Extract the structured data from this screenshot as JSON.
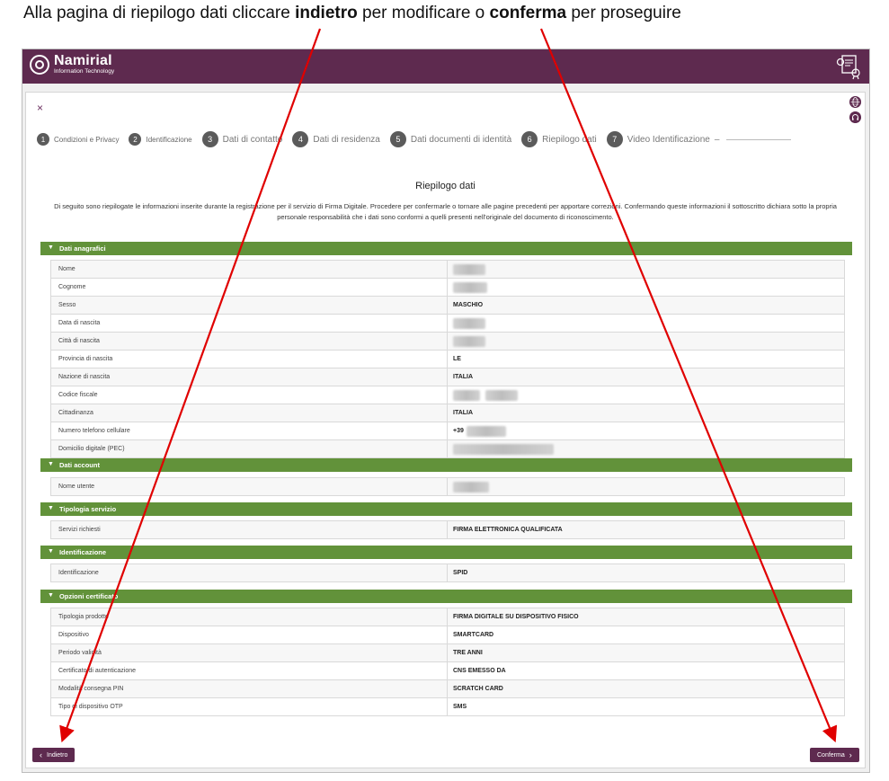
{
  "caption": {
    "pre": "Alla pagina di riepilogo  dati cliccare ",
    "b1": "indietro",
    "mid": " per modificare o ",
    "b2": "conferma",
    "post": " per proseguire"
  },
  "brand": {
    "name": "Namirial",
    "sub": "Information Technology"
  },
  "close_symbol": "×",
  "steps": [
    {
      "num": "1",
      "label": "Condizioni e Privacy"
    },
    {
      "num": "2",
      "label": "Identificazione"
    },
    {
      "num": "3",
      "label": "Dati di contatto"
    },
    {
      "num": "4",
      "label": "Dati di residenza"
    },
    {
      "num": "5",
      "label": "Dati documenti di identità"
    },
    {
      "num": "6",
      "label": "Riepilogo dati"
    },
    {
      "num": "7",
      "label": "Video Identificazione"
    }
  ],
  "step_suffix": "–",
  "title": "Riepilogo dati",
  "intro": "Di seguito sono riepilogate le informazioni inserite durante la registrazione per il servizio di Firma Digitale. Procedere per confermarle o tornare alle pagine precedenti per apportare correzioni. Confermando queste informazioni il sottoscritto dichiara sotto la propria personale responsabilità che i dati sono conformi a quelli presenti nell'originale del documento di riconoscimento.",
  "sections": {
    "anagrafici": {
      "title": "Dati anagrafici",
      "rows": [
        {
          "label": "Nome",
          "value": ""
        },
        {
          "label": "Cognome",
          "value": ""
        },
        {
          "label": "Sesso",
          "value": "MASCHIO"
        },
        {
          "label": "Data di nascita",
          "value": ""
        },
        {
          "label": "Città di nascita",
          "value": ""
        },
        {
          "label": "Provincia di nascita",
          "value": "LE"
        },
        {
          "label": "Nazione di nascita",
          "value": "ITALIA"
        },
        {
          "label": "Codice fiscale",
          "value": ""
        },
        {
          "label": "Cittadinanza",
          "value": "ITALIA"
        },
        {
          "label": "Numero telefono cellulare",
          "value": "+39"
        },
        {
          "label": "Domicilio digitale (PEC)",
          "value": ""
        }
      ]
    },
    "account": {
      "title": "Dati account",
      "rows": [
        {
          "label": "Nome utente",
          "value": ""
        }
      ]
    },
    "servizio": {
      "title": "Tipologia servizio",
      "rows": [
        {
          "label": "Servizi richiesti",
          "value": "FIRMA ELETTRONICA QUALIFICATA"
        }
      ]
    },
    "identificazione": {
      "title": "Identificazione",
      "rows": [
        {
          "label": "Identificazione",
          "value": "SPID"
        }
      ]
    },
    "opzioni": {
      "title": "Opzioni certificato",
      "rows": [
        {
          "label": "Tipologia prodotto",
          "value": "FIRMA DIGITALE SU DISPOSITIVO FISICO"
        },
        {
          "label": "Dispositivo",
          "value": "SMARTCARD"
        },
        {
          "label": "Periodo validità",
          "value": "TRE ANNI"
        },
        {
          "label": "Certificato di autenticazione",
          "value": "CNS EMESSO DA"
        },
        {
          "label": "Modalità consegna PIN",
          "value": "SCRATCH CARD"
        },
        {
          "label": "Tipo di dispositivo OTP",
          "value": "SMS"
        }
      ]
    }
  },
  "buttons": {
    "back_icon": "‹",
    "back": "Indietro",
    "confirm": "Conferma",
    "confirm_icon": "›"
  },
  "colors": {
    "brand": "#5e2a4f",
    "section": "#62923a",
    "arrow": "#e00000"
  },
  "icons": [
    "document-certificate-icon",
    "globe-icon",
    "headset-icon",
    "chevron-down-icon",
    "arrow-annotation"
  ]
}
